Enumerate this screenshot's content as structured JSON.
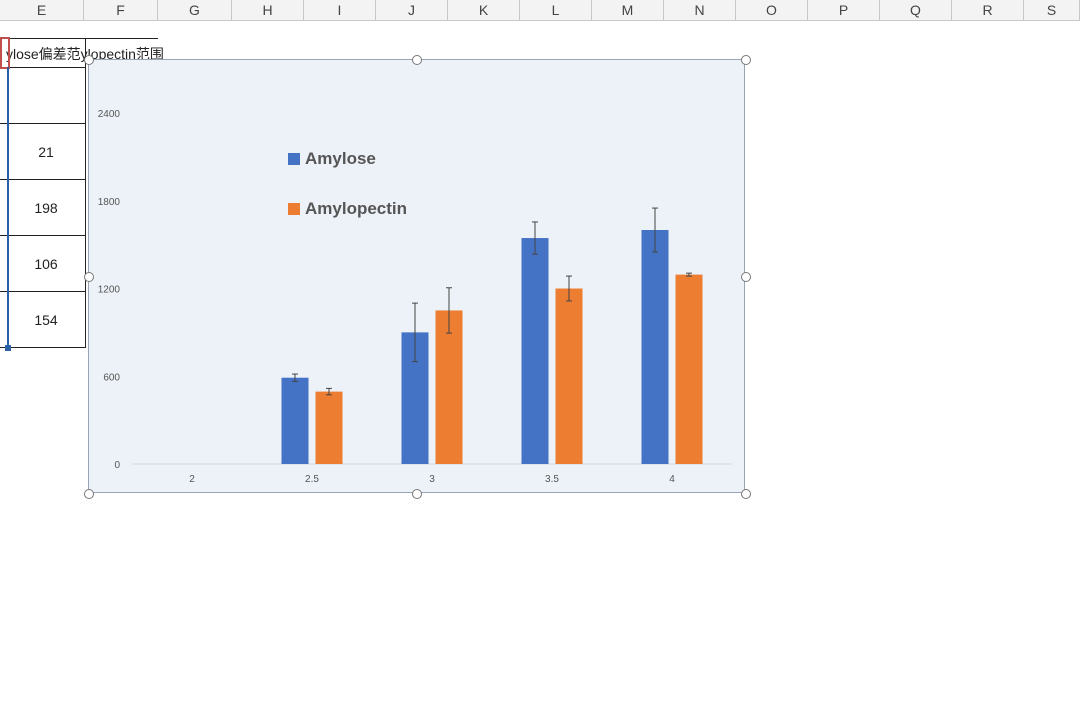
{
  "sheet": {
    "columns": [
      "E",
      "F",
      "G",
      "H",
      "I",
      "J",
      "K",
      "L",
      "M",
      "N",
      "O",
      "P",
      "Q",
      "R",
      "S"
    ],
    "header_cell_text": "ylose偏差范ylopectin范围",
    "column_e_values": [
      "21",
      "198",
      "106",
      "154"
    ]
  },
  "chart_data": {
    "type": "bar",
    "categories": [
      "2",
      "2.5",
      "3",
      "3.5",
      "4"
    ],
    "series": [
      {
        "name": "Amylose",
        "color": "#4472c4",
        "values": [
          0,
          590,
          900,
          1545,
          1600
        ],
        "error": [
          0,
          25,
          200,
          110,
          150
        ]
      },
      {
        "name": "Amylopectin",
        "color": "#ed7d31",
        "values": [
          0,
          495,
          1050,
          1200,
          1295
        ],
        "error": [
          0,
          22,
          155,
          85,
          10
        ]
      }
    ],
    "ylim": [
      0,
      2400
    ],
    "yticks": [
      "0",
      "600",
      "1200",
      "1800",
      "2400"
    ],
    "legend_position": "top-left",
    "grid": false
  }
}
